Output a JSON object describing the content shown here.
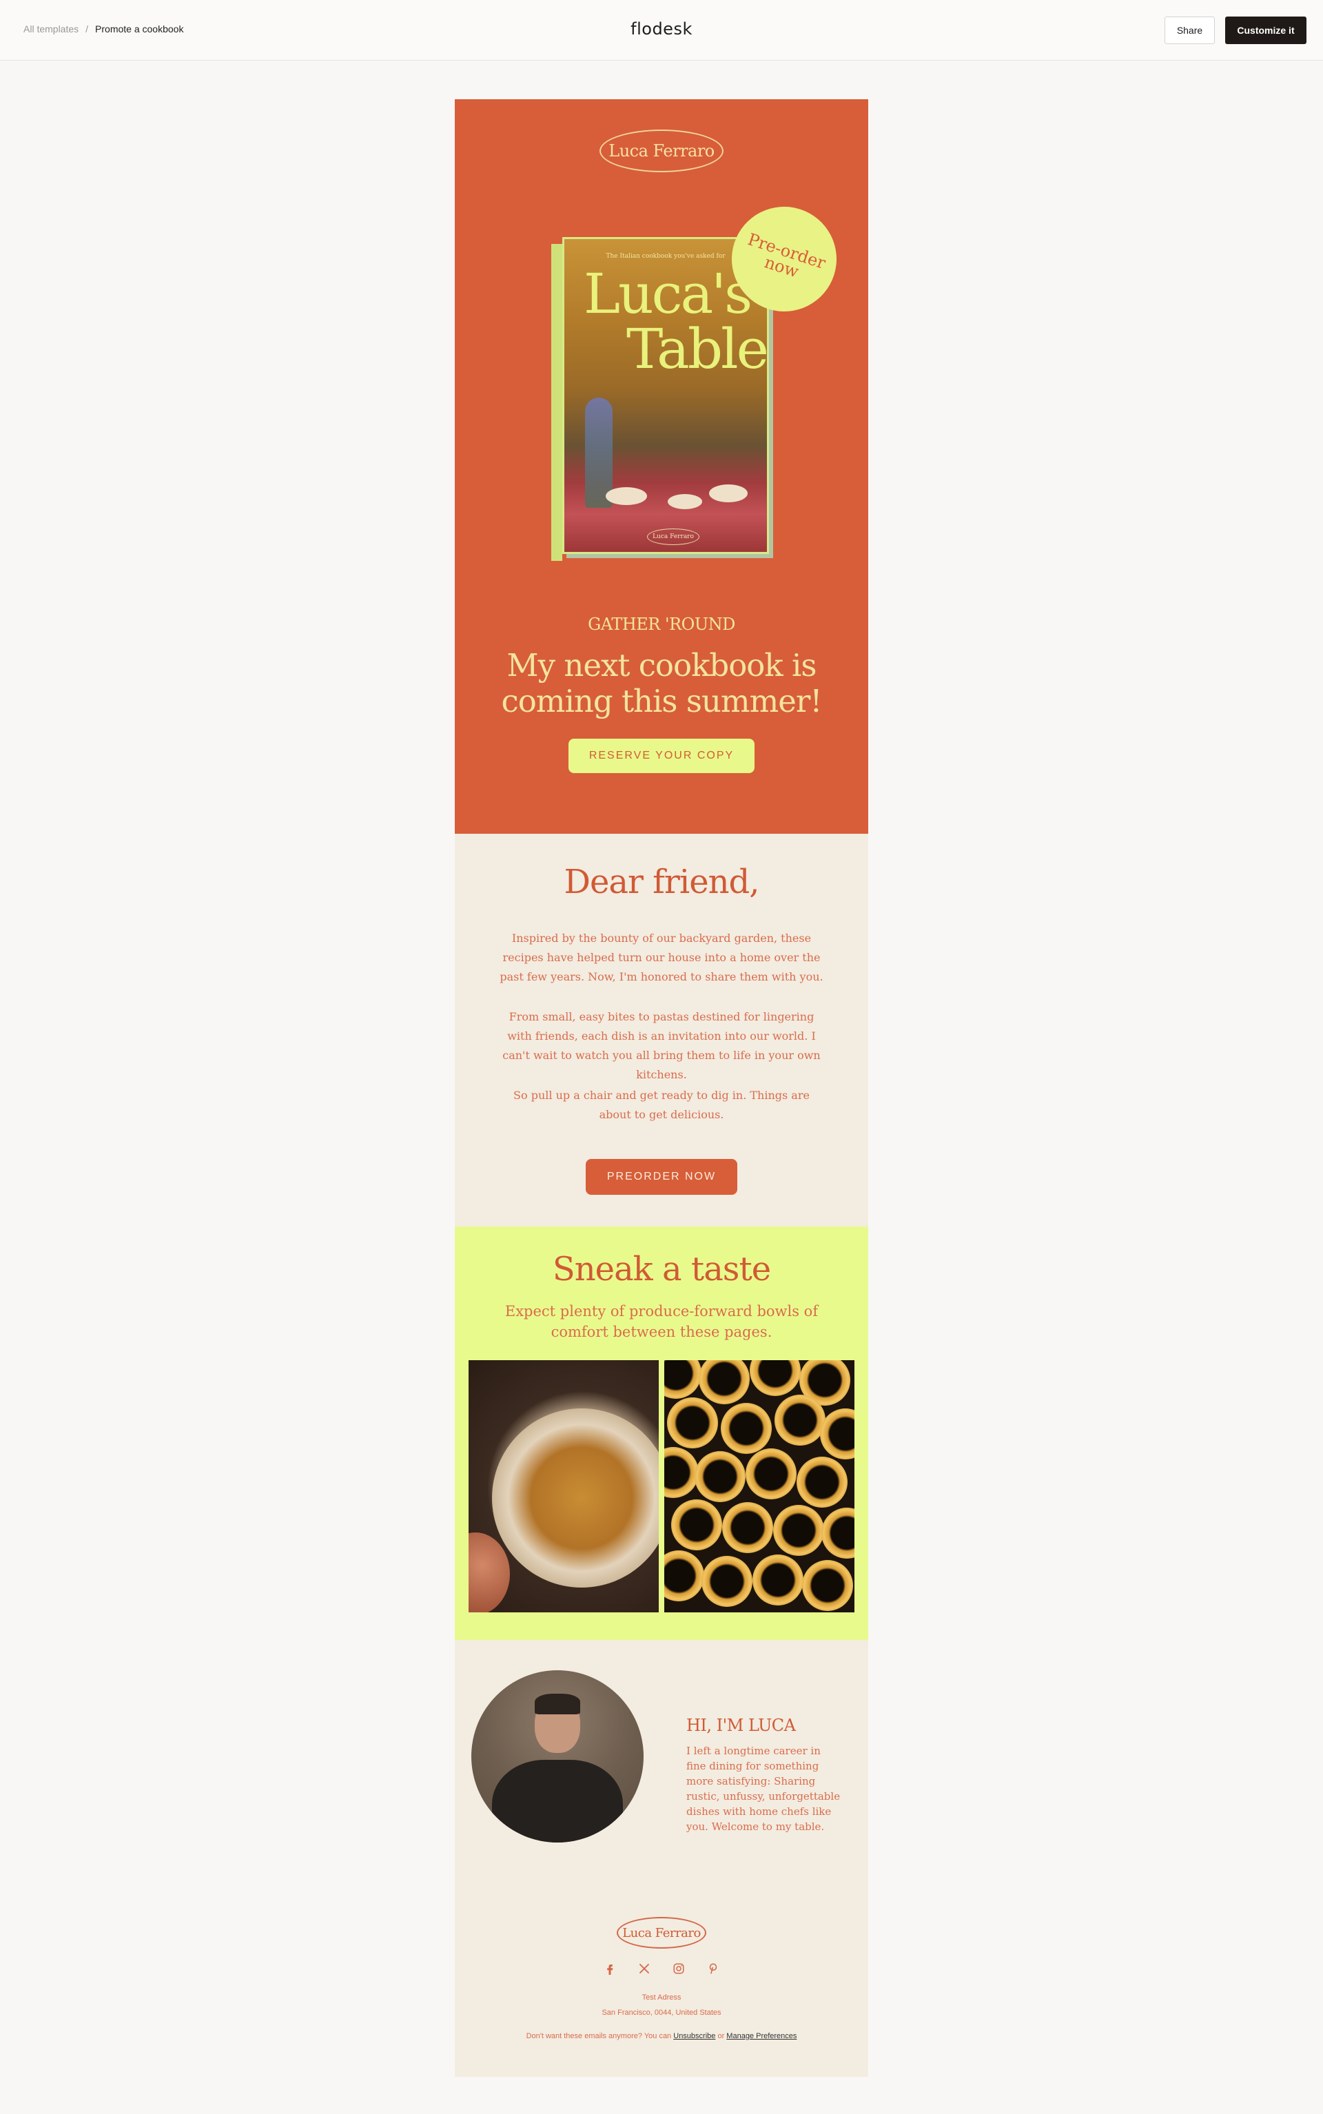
{
  "header": {
    "breadcrumb_root": "All templates",
    "breadcrumb_separator": "/",
    "breadcrumb_current": "Promote a cookbook",
    "brand": "flodesk",
    "share_label": "Share",
    "customize_label": "Customize it"
  },
  "hero": {
    "logo_text": "Luca Ferraro",
    "book_tagline": "The Italian cookbook you've asked for",
    "book_title_line1": "Luca's",
    "book_title_line2": "Table",
    "book_author": "Luca Ferraro",
    "badge_line1": "Pre-order",
    "badge_line2": "now",
    "eyebrow": "GATHER 'ROUND",
    "headline": "My next cookbook is coming this summer!",
    "cta_label": "RESERVE YOUR COPY"
  },
  "letter": {
    "greeting": "Dear friend,",
    "paragraph1": "Inspired by the bounty of our backyard garden, these recipes have helped turn our house into a home over the past few years. Now, I'm honored to share them with you.",
    "paragraph2": "From small, easy bites to pastas destined for lingering with friends, each dish is an invitation into our world. I can't wait to watch you all bring them to life in your own kitchens.",
    "paragraph3": "So pull up a chair and get ready to dig in. Things are about to get delicious.",
    "cta_label": "PREORDER NOW"
  },
  "taste": {
    "title": "Sneak a taste",
    "subtitle": "Expect plenty of produce-forward bowls of comfort between these pages."
  },
  "about": {
    "heading": "HI, I'M LUCA",
    "bio": "I left a longtime career in fine dining for something more satisfying: Sharing rustic, unfussy, unforgettable dishes with home chefs like you. Welcome to my table."
  },
  "footer": {
    "logo_text": "Luca Ferraro",
    "socials": [
      "facebook-icon",
      "x-icon",
      "instagram-icon",
      "pinterest-icon"
    ],
    "address_line1": "Test Adress",
    "address_line2": "San Francisco, 0044, United States",
    "unsubscribe_prefix": "Don't want these emails anymore? You can",
    "unsubscribe_link": "Unsubscribe",
    "unsubscribe_or": "or",
    "preferences_link": "Manage Preferences"
  },
  "colors": {
    "accent": "#d75e39",
    "lime": "#e9fa8d",
    "cream": "#f3ece0",
    "dark": "#1f1a17"
  }
}
